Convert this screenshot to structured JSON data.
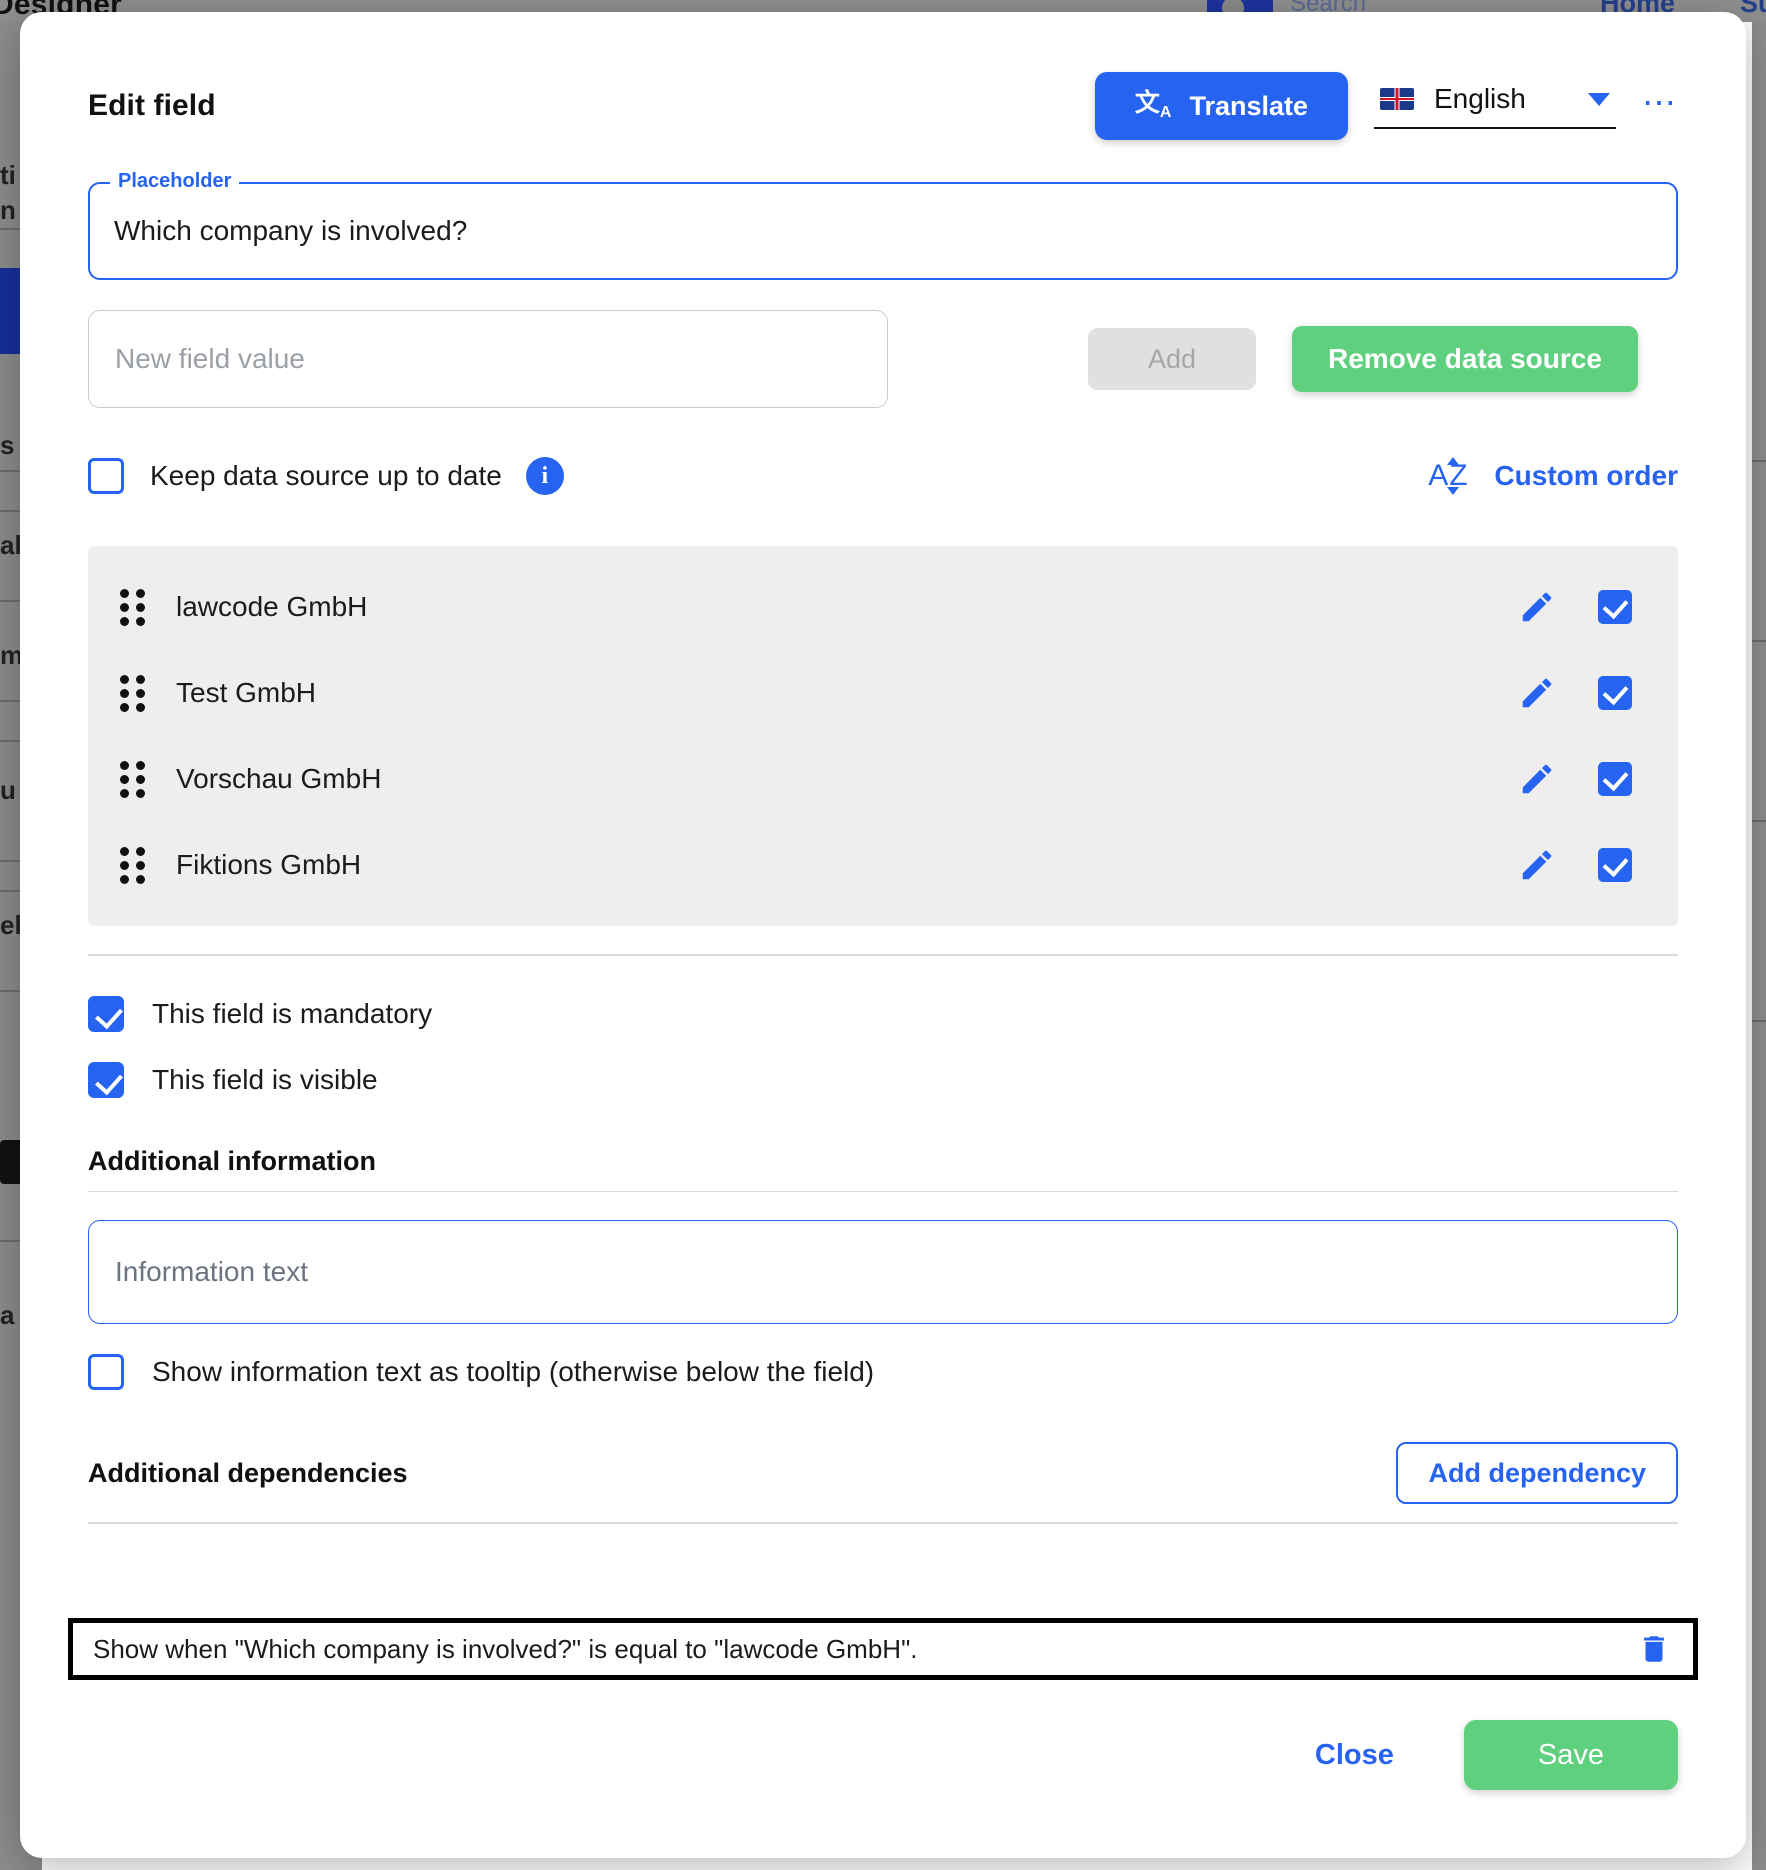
{
  "background": {
    "app_title": "Designer",
    "search_label": "Search",
    "nav_home": "Home",
    "nav_su": "Su"
  },
  "modal": {
    "title": "Edit field",
    "translate_button": "Translate",
    "translate_icon": "translate-icon",
    "language": {
      "flag": "uk-flag-icon",
      "value": "English",
      "caret_icon": "chevron-down-icon"
    },
    "more_icon": "kebab-menu-icon",
    "placeholder_field": {
      "legend": "Placeholder",
      "value": "Which company is involved?"
    },
    "new_field_value": {
      "placeholder": "New field value",
      "value": ""
    },
    "add_button": "Add",
    "remove_source_button": "Remove data source",
    "keep_updated": {
      "label": "Keep data source up to date",
      "checked": false,
      "info_icon": "info-icon"
    },
    "custom_order": {
      "label": "Custom order",
      "icon": "sort-alpha-icon"
    },
    "values": [
      {
        "label": "lawcode GmbH",
        "checked": true
      },
      {
        "label": "Test GmbH",
        "checked": true
      },
      {
        "label": "Vorschau GmbH",
        "checked": true
      },
      {
        "label": "Fiktions GmbH",
        "checked": true
      }
    ],
    "mandatory": {
      "label": "This field is mandatory",
      "checked": true
    },
    "visible": {
      "label": "This field is visible",
      "checked": true
    },
    "additional_information": {
      "section_title": "Additional information",
      "input_placeholder": "Information text",
      "input_value": "",
      "tooltip_label": "Show information text as tooltip (otherwise below the field)",
      "tooltip_checked": false
    },
    "dependencies": {
      "section_title": "Additional dependencies",
      "add_button": "Add dependency",
      "items": [
        {
          "text": "Show when \"Which company is involved?\" is equal to \"lawcode GmbH\".",
          "delete_icon": "trash-icon"
        }
      ]
    },
    "footer": {
      "close_button": "Close",
      "save_button": "Save"
    }
  },
  "colors": {
    "accent_blue": "#2563f0",
    "green": "#5fd07e",
    "disabled_gray": "#e0e0e0",
    "list_bg": "#eeeeee"
  }
}
